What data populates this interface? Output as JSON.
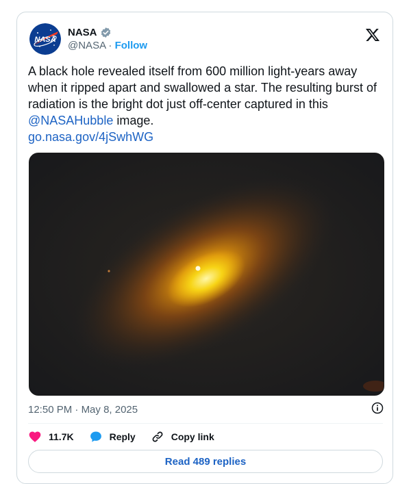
{
  "author": {
    "name": "NASA",
    "handle": "@NASA",
    "separator": "·",
    "follow_label": "Follow",
    "avatar_icon": "nasa-meatball-logo",
    "verified_icon": "verified-badge-icon"
  },
  "platform_icon": "x-logo-icon",
  "tweet": {
    "text_part1": "A black hole revealed itself from 600 million light-years away when it ripped apart and swallowed a star. The resulting burst of radiation is the bright dot just off-center captured in this ",
    "mention": "@NASAHubble",
    "text_part2": " image.",
    "link": "go.nasa.gov/4jSwhWG"
  },
  "media": {
    "alt_description_icon": "hubble-galaxy-image"
  },
  "meta": {
    "time": "12:50 PM",
    "separator": "·",
    "date": "May 8, 2025",
    "info_icon": "info-icon"
  },
  "actions": {
    "like_count": "11.7K",
    "reply_label": "Reply",
    "copy_link_label": "Copy link"
  },
  "replies_button": "Read 489 replies",
  "colors": {
    "link": "#1d63c4",
    "verified": "#829aab",
    "like": "#f91880",
    "reply": "#1d9bf0"
  }
}
